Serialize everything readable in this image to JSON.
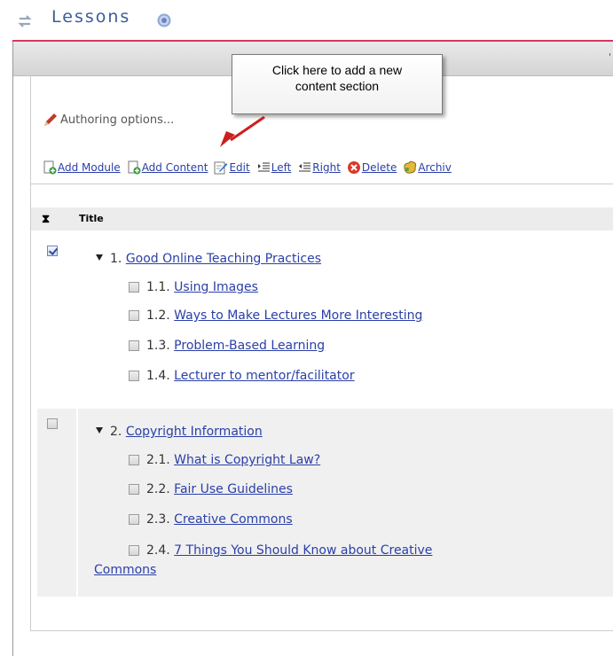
{
  "header": {
    "title": "Lessons",
    "greybar_glyph": "'"
  },
  "callout": {
    "line1": "Click here to add a new",
    "line2": "content section"
  },
  "authoring": {
    "label": "Authoring options..."
  },
  "toolbar": {
    "add_module": "Add Module",
    "add_content": "Add Content",
    "edit": "Edit",
    "left": "Left",
    "right": "Right",
    "delete": "Delete",
    "archive": "Archiv"
  },
  "table": {
    "sort_icon": "⧗",
    "title_header": "Title"
  },
  "modules": [
    {
      "number": "1.",
      "title": "Good Online Teaching Practices",
      "checked": true,
      "items": [
        {
          "number": "1.1.",
          "title": "Using Images"
        },
        {
          "number": "1.2.",
          "title": "Ways to Make Lectures More Interesting"
        },
        {
          "number": "1.3.",
          "title": "Problem-Based Learning"
        },
        {
          "number": "1.4.",
          "title": "Lecturer to mentor/facilitator"
        }
      ]
    },
    {
      "number": "2.",
      "title": "Copyright Information",
      "checked": false,
      "items": [
        {
          "number": "2.1.",
          "title": "What is Copyright Law?"
        },
        {
          "number": "2.2.",
          "title": "Fair Use Guidelines"
        },
        {
          "number": "2.3.",
          "title": "Creative Commons"
        },
        {
          "number": "2.4.",
          "title": "7 Things You Should Know about Creative",
          "title_cont": "Commons"
        }
      ]
    }
  ],
  "colors": {
    "accent_rule": "#d8385c",
    "title_blue": "#3b5d99",
    "link": "#2a3fa8",
    "arrow": "#cc1f1f"
  }
}
